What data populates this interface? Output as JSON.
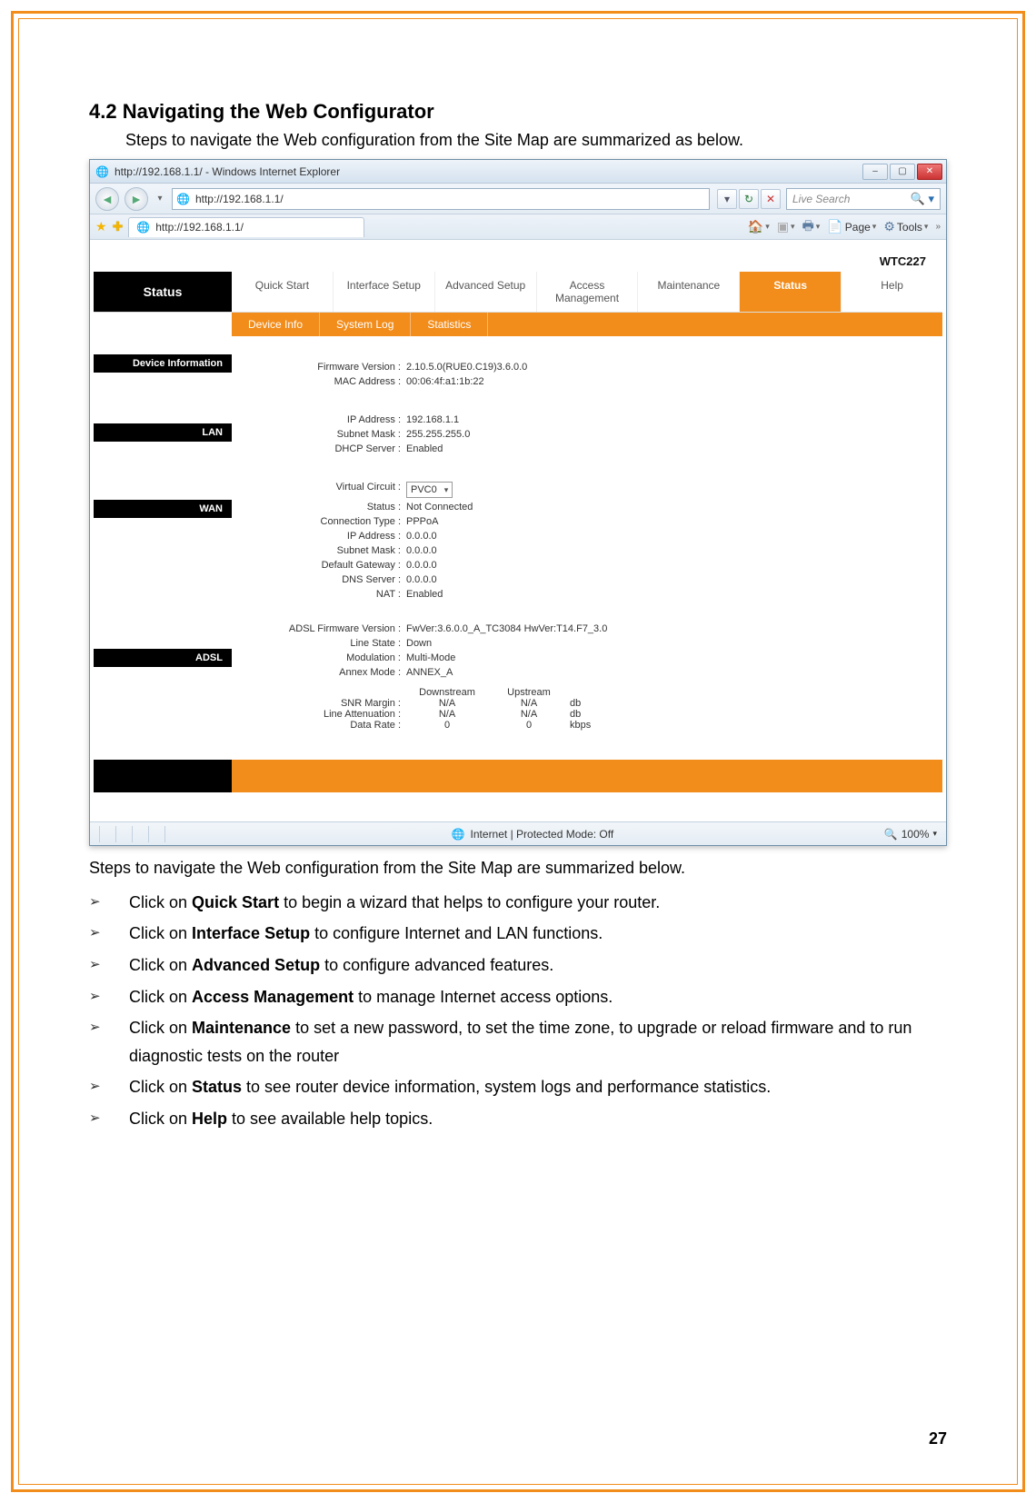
{
  "document": {
    "section_title": "4.2 Navigating the Web Configurator",
    "intro": "Steps to navigate the Web configuration from the Site Map are summarized as below.",
    "post_intro": "Steps to navigate the Web configuration from the Site Map are summarized below.",
    "page_number": "27",
    "steps": [
      {
        "prefix": "Click on ",
        "bold": "Quick Start",
        "suffix": " to begin a wizard that helps to configure your router."
      },
      {
        "prefix": "Click on ",
        "bold": "Interface Setup",
        "suffix": " to configure Internet and LAN functions."
      },
      {
        "prefix": "Click on ",
        "bold": "Advanced Setup",
        "suffix": " to configure advanced features."
      },
      {
        "prefix": "Click on ",
        "bold": "Access Management",
        "suffix": " to manage Internet access options."
      },
      {
        "prefix": "Click on ",
        "bold": "Maintenance",
        "suffix": " to set a new password, to set the time zone, to upgrade or reload firmware and to run diagnostic tests on the router"
      },
      {
        "prefix": "Click on ",
        "bold": "Status",
        "suffix": " to see router device information, system logs and performance statistics."
      },
      {
        "prefix": "Click on ",
        "bold": "Help",
        "suffix": " to see available help topics."
      }
    ]
  },
  "ie": {
    "title": "http://192.168.1.1/ - Windows Internet Explorer",
    "address": "http://192.168.1.1/",
    "search_placeholder": "Live Search",
    "tab_label": "http://192.168.1.1/",
    "toolbar": {
      "page": "Page",
      "tools": "Tools"
    },
    "statusbar": {
      "mode": "Internet | Protected Mode: Off",
      "zoom": "100%"
    }
  },
  "router": {
    "model": "WTC227",
    "main_tabs": {
      "status_heading": "Status",
      "items": [
        "Quick Start",
        "Interface Setup",
        "Advanced Setup",
        "Access Management",
        "Maintenance",
        "Status",
        "Help"
      ]
    },
    "sub_tabs": [
      "Device Info",
      "System Log",
      "Statistics"
    ],
    "sections": {
      "device_info": {
        "label": "Device Information",
        "rows": [
          {
            "k": "Firmware Version :",
            "v": "2.10.5.0(RUE0.C19)3.6.0.0"
          },
          {
            "k": "MAC Address :",
            "v": "00:06:4f:a1:1b:22"
          }
        ]
      },
      "lan": {
        "label": "LAN",
        "rows": [
          {
            "k": "IP Address :",
            "v": "192.168.1.1"
          },
          {
            "k": "Subnet Mask :",
            "v": "255.255.255.0"
          },
          {
            "k": "DHCP Server :",
            "v": "Enabled"
          }
        ]
      },
      "wan": {
        "label": "WAN",
        "virtual_circuit": {
          "k": "Virtual Circuit :",
          "v": "PVC0"
        },
        "rows": [
          {
            "k": "Status :",
            "v": "Not Connected"
          },
          {
            "k": "Connection Type :",
            "v": "PPPoA"
          },
          {
            "k": "IP Address :",
            "v": "0.0.0.0"
          },
          {
            "k": "Subnet Mask :",
            "v": "0.0.0.0"
          },
          {
            "k": "Default Gateway :",
            "v": "0.0.0.0"
          },
          {
            "k": "DNS Server :",
            "v": "0.0.0.0"
          },
          {
            "k": "NAT :",
            "v": "Enabled"
          }
        ]
      },
      "adsl": {
        "label": "ADSL",
        "rows": [
          {
            "k": "ADSL Firmware Version :",
            "v": "FwVer:3.6.0.0_A_TC3084 HwVer:T14.F7_3.0"
          },
          {
            "k": "Line State :",
            "v": "Down"
          },
          {
            "k": "Modulation :",
            "v": "Multi-Mode"
          },
          {
            "k": "Annex Mode :",
            "v": "ANNEX_A"
          }
        ],
        "table": {
          "cols": [
            "Downstream",
            "Upstream"
          ],
          "rows": [
            {
              "label": "SNR Margin :",
              "down": "N/A",
              "up": "N/A",
              "unit": "db"
            },
            {
              "label": "Line Attenuation :",
              "down": "N/A",
              "up": "N/A",
              "unit": "db"
            },
            {
              "label": "Data Rate :",
              "down": "0",
              "up": "0",
              "unit": "kbps"
            }
          ]
        }
      }
    }
  }
}
